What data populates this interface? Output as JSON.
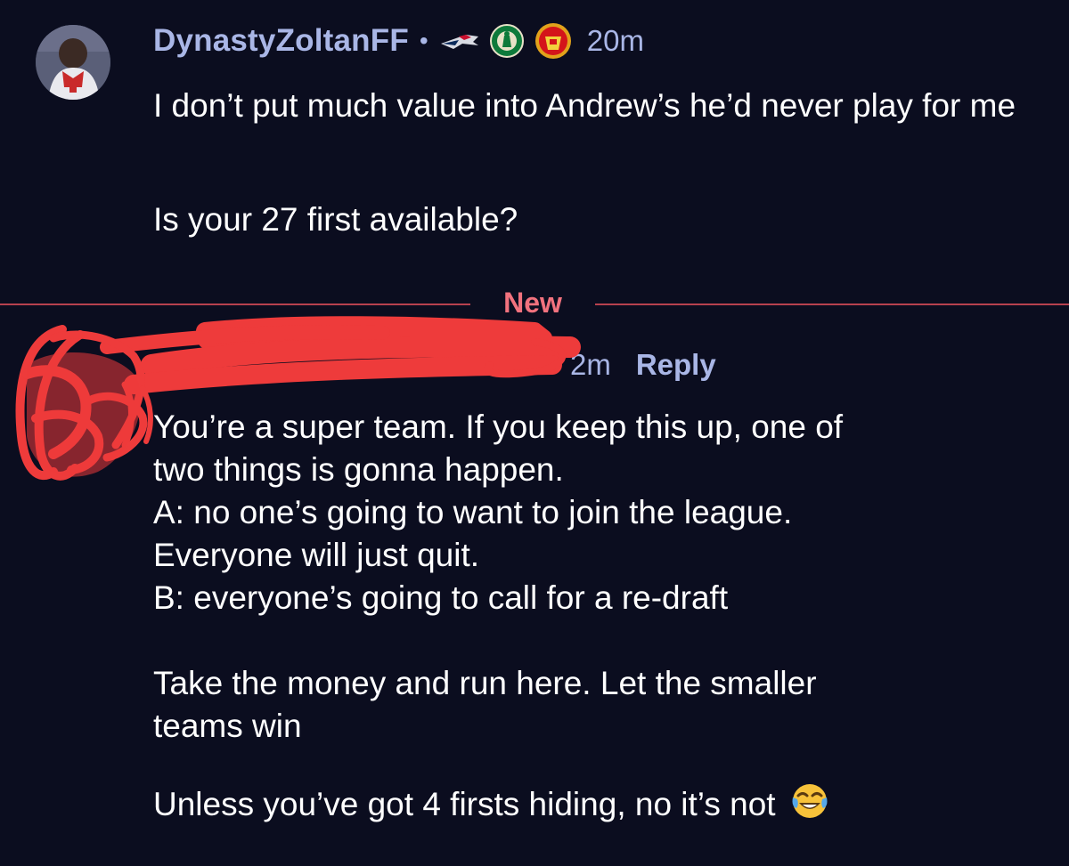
{
  "comments": [
    {
      "username": "DynastyZoltanFF",
      "separator": "•",
      "badges": [
        "patriots-badge-icon",
        "celtics-badge-icon",
        "man-united-badge-icon"
      ],
      "timestamp": "20m",
      "paragraphs": [
        "I don’t put much value into Andrew’s he’d never play for me",
        "Is your 27 first available?"
      ]
    },
    {
      "username": "",
      "timestamp": "2m",
      "reply_label": "Reply",
      "lines": [
        "You’re a super team. If you keep this up, one of",
        "two things is gonna happen.",
        "A: no one’s going to want to join the league.",
        "Everyone will just quit.",
        "B: everyone’s going to call for a re-draft",
        "Take the money and run here. Let the smaller",
        "teams win",
        "Unless you’ve got 4 firsts hiding, no it’s not"
      ],
      "emoji": "face-with-tears-of-joy-icon"
    }
  ],
  "divider": {
    "label": "New"
  },
  "colors": {
    "background": "#0b0d1f",
    "username": "#a9b6e6",
    "new_divider": "#b7414e",
    "new_label": "#f2727e",
    "redaction": "#ee3b3b"
  }
}
